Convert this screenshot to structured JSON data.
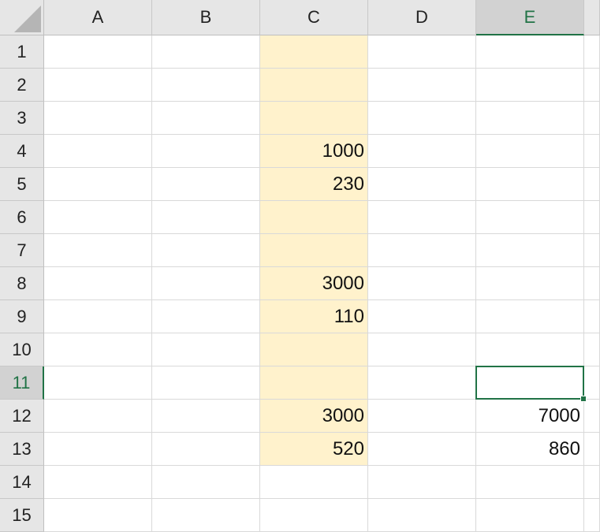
{
  "columns": [
    "A",
    "B",
    "C",
    "D",
    "E"
  ],
  "rows": [
    "1",
    "2",
    "3",
    "4",
    "5",
    "6",
    "7",
    "8",
    "9",
    "10",
    "11",
    "12",
    "13",
    "14",
    "15"
  ],
  "selected_cell": {
    "column": "E",
    "row": "11"
  },
  "fill_color": "#fff2cc",
  "accent_color": "#217346",
  "filled_column": "C",
  "filled_rows": [
    "1",
    "2",
    "3",
    "4",
    "5",
    "6",
    "7",
    "8",
    "9",
    "10",
    "11",
    "12",
    "13"
  ],
  "cells": {
    "C4": "1000",
    "C5": "230",
    "C8": "3000",
    "C9": "110",
    "C12": "3000",
    "C13": "520",
    "E12": "7000",
    "E13": "860"
  }
}
